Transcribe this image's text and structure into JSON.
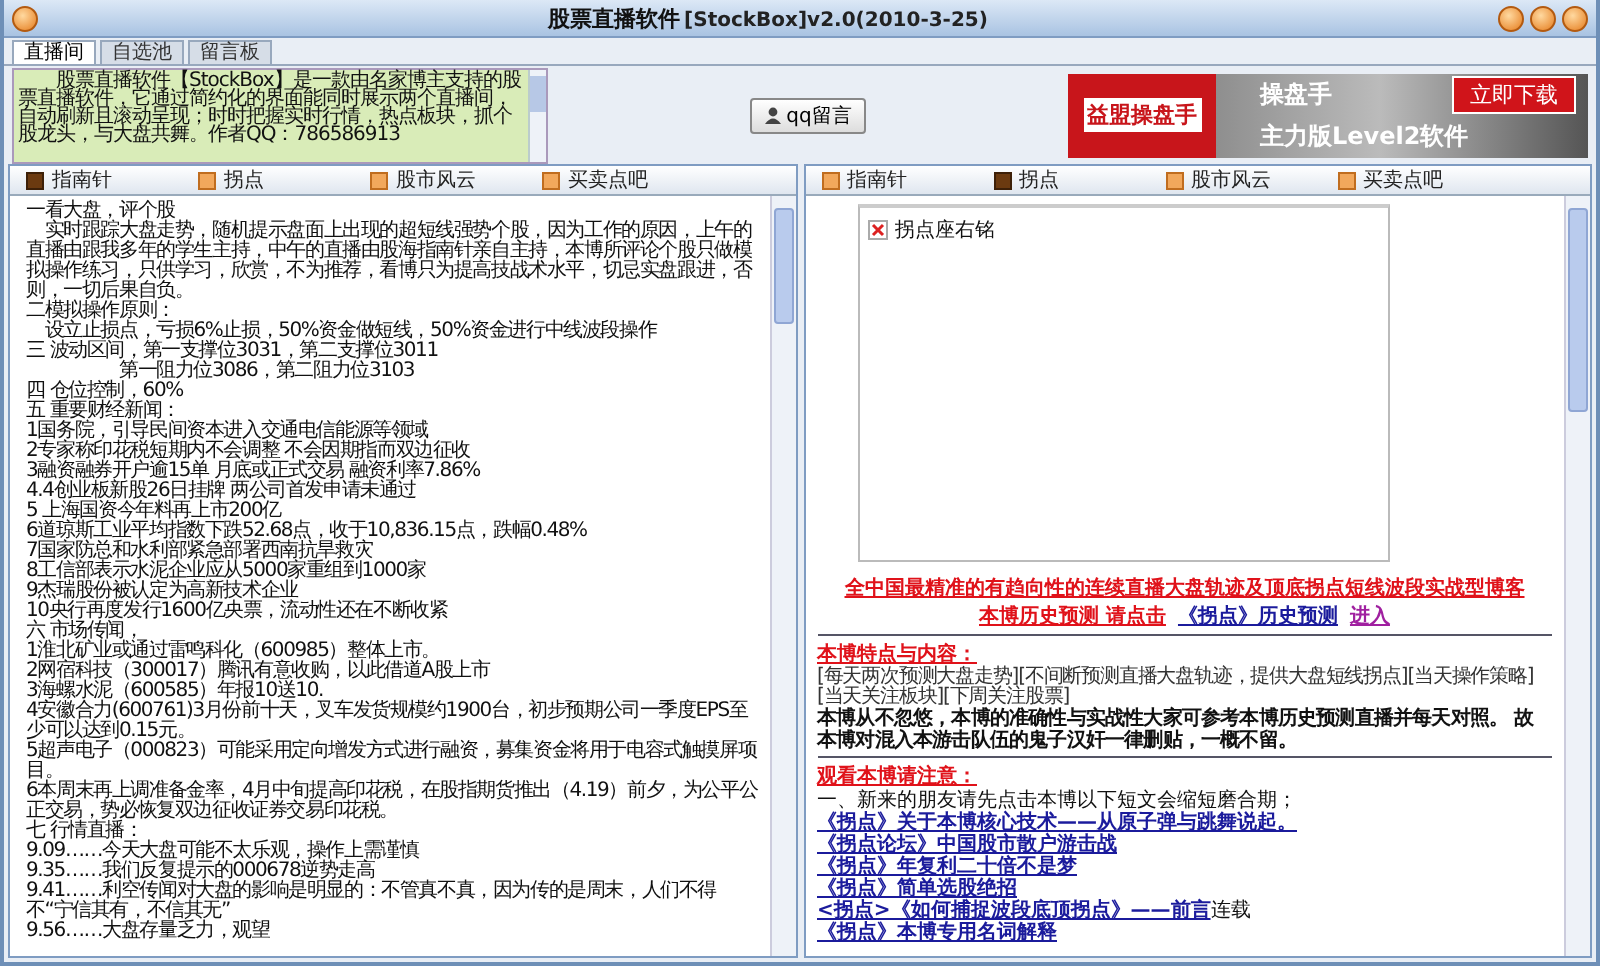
{
  "window": {
    "title": "股票直播软件",
    "version": "[StockBox]v2.0(2010-3-25)"
  },
  "tabs": [
    {
      "label": "直播间",
      "selected": true
    },
    {
      "label": "自选池",
      "selected": false
    },
    {
      "label": "留言板",
      "selected": false
    }
  ],
  "intro": {
    "text": "　　股票直播软件【StockBox】是一款由名家博主支持的股票直播软件，它通过简约化的界面能同时展示两个直播间，自动刷新且滚动呈现；时时把握实时行情，热点板块，抓个股龙头，与大盘共舞。作者QQ：786586913"
  },
  "qq_button": {
    "label": "qq留言"
  },
  "ad": {
    "brand": "益盟操盘手",
    "product": "操盘手",
    "edition": "主力版Level2软件",
    "button": "立即下载"
  },
  "left_panel": {
    "toolbar": [
      {
        "label": "指南针",
        "selected": true
      },
      {
        "label": "拐点",
        "selected": false
      },
      {
        "label": "股市风云",
        "selected": false
      },
      {
        "label": "买卖点吧",
        "selected": false
      }
    ],
    "lines": [
      "一看大盘，评个股",
      "　实时跟踪大盘走势，随机提示盘面上出现的超短线强势个股，因为工作的原因，上午的直播由跟我多年的学生主持，中午的直播由股海指南针亲自主持，本博所评论个股只做模拟操作练习，只供学习，欣赏，不为推荐，看博只为提高技战术水平，切忌实盘跟进，否则，一切后果自负。",
      "二模拟操作原则：",
      "　设立止损点，亏损6%止损，50%资金做短线，50%资金进行中线波段操作",
      "三 波动区间，第一支撑位3031，第二支撑位3011",
      "　　　　　第一阻力位3086，第二阻力位3103",
      "四 仓位控制，60%",
      "五 重要财经新闻：",
      "1国务院，引导民间资本进入交通电信能源等领域",
      "2专家称印花税短期内不会调整 不会因期指而双边征收",
      "3融资融券开户逾15单 月底或正式交易 融资利率7.86%",
      "4.4创业板新股26日挂牌 两公司首发申请未通过",
      "5 上海国资今年料再上市200亿",
      "6道琼斯工业平均指数下跌52.68点，收于10,836.15点，跌幅0.48%",
      "7国家防总和水利部紧急部署西南抗旱救灾",
      "8工信部表示水泥企业应从5000家重组到1000家",
      "9杰瑞股份被认定为高新技术企业",
      "10央行再度发行1600亿央票，流动性还在不断收紧",
      "六 市场传闻，",
      "1淮北矿业或通过雷鸣科化（600985）整体上市。",
      "2网宿科技（300017）腾讯有意收购，以此借道A股上市",
      "3海螺水泥（600585）年报10送10.",
      "4安徽合力(600761)3月份前十天，叉车发货规模约1900台，初步预期公司一季度EPS至少可以达到0.15元。",
      "5超声电子（000823）可能采用定向增发方式进行融资，募集资金将用于电容式触摸屏项目。",
      "6本周末再上调准备金率，4月中旬提高印花税，在股指期货推出（4.19）前夕，为公平公正交易，势必恢复双边征收证券交易印花税。",
      "七 行情直播：",
      "9.09……今天大盘可能不太乐观，操作上需谨慎",
      "9.35……我们反复提示的000678逆势走高",
      "9.41……利空传闻对大盘的影响是明显的：不管真不真，因为传的是周末，人们不得不“宁信其有，不信其无”",
      "9.56……大盘存量乏力，观望"
    ]
  },
  "right_panel": {
    "toolbar": [
      {
        "label": "指南针",
        "selected": false
      },
      {
        "label": "拐点",
        "selected": true
      },
      {
        "label": "股市风云",
        "selected": false
      },
      {
        "label": "买卖点吧",
        "selected": false
      }
    ],
    "image_alt": "拐点座右铭",
    "headline": "全中国最精准的有趋向性的连续直播大盘轨迹及顶底拐点短线波段实战型博客",
    "history": [
      {
        "kind": "plain",
        "text": "本博历史预测 请点击"
      },
      {
        "kind": "link",
        "text": "《拐点》历史预测"
      },
      {
        "kind": "visited",
        "text": "进入"
      }
    ],
    "features_title": "本博特点与内容：",
    "features": "[每天两次预测大盘走势][不间断预测直播大盘轨迹，提供大盘短线拐点][当天操作策略][当天关注板块][下周关注股票]",
    "statement": "本博从不忽悠，本博的准确性与实战性大家可参考本博历史预测直播并每天对照。 故本博对混入本游击队伍的鬼子汉奸一律删贴，一概不留。",
    "notice_title": "观看本博请注意：",
    "notice": "一、新来的朋友请先点击本博以下短文会缩短磨合期；",
    "links": [
      {
        "text": "《拐点》关于本博核心技术——从原子弹与跳舞说起。"
      },
      {
        "text": "《拐点论坛》中国股市散户游击战"
      },
      {
        "text": "《拐点》年复利二十倍不是梦"
      },
      {
        "text": "《拐点》简单选股绝招"
      },
      {
        "text": "<拐点>《如何捕捉波段底顶拐点》——前言",
        "note": "连载"
      },
      {
        "text": "《拐点》本博专用名词解释"
      }
    ]
  }
}
